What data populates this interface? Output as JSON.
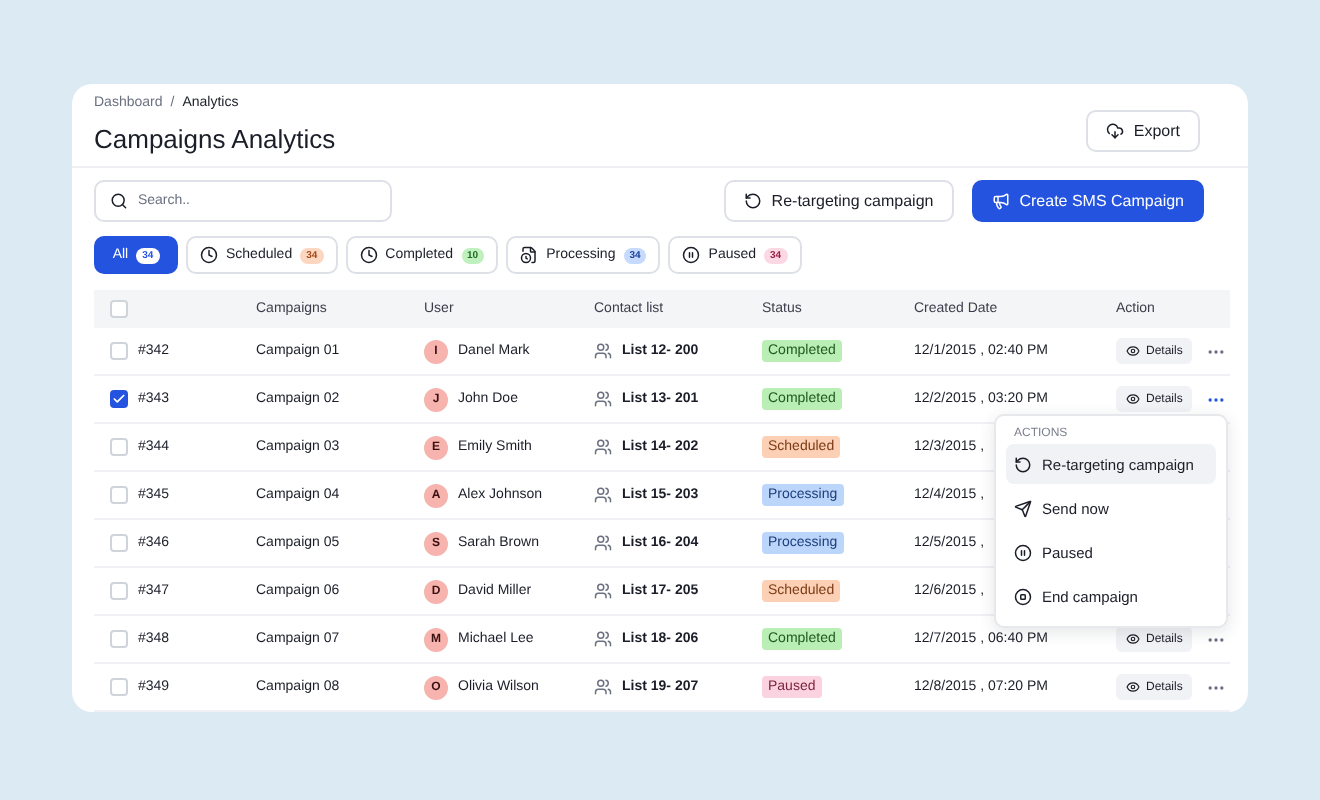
{
  "breadcrumb": [
    "Dashboard",
    "/",
    "Analytics"
  ],
  "title": "Campaigns Analytics",
  "export_button": "Export",
  "search": {
    "placeholder": "Search.."
  },
  "actions": [
    {
      "kind": "retarget",
      "label": "Re-targeting campaign"
    },
    {
      "kind": "create",
      "label": "Create SMS Campaign"
    }
  ],
  "tabs": [
    {
      "kind": "all",
      "label": "All",
      "count": "34",
      "selected": true
    },
    {
      "kind": "scheduled",
      "label": "Scheduled",
      "count": "34",
      "selected": false
    },
    {
      "kind": "completed",
      "label": "Completed",
      "count": "10",
      "selected": false
    },
    {
      "kind": "processing",
      "label": "Processing",
      "count": "34",
      "selected": false
    },
    {
      "kind": "paused",
      "label": "Paused",
      "count": "34",
      "selected": false
    }
  ],
  "table": {
    "header_checked": false,
    "columns": [
      "Campaigns",
      "User",
      "Contact list",
      "Status",
      "Created Date",
      "Action"
    ],
    "rows": [
      {
        "id": "#342",
        "checked": false,
        "campaign": "Campaign 01",
        "initial": "I",
        "user": "Danel Mark",
        "list": "List 12- 200",
        "status": {
          "kind": "completed",
          "label": "Completed"
        },
        "date": "12/1/2015 , 02:40 PM",
        "details": "Details",
        "menu_open": false
      },
      {
        "id": "#343",
        "checked": true,
        "campaign": "Campaign 02",
        "initial": "J",
        "user": "John Doe",
        "list": "List 13- 201",
        "status": {
          "kind": "completed",
          "label": "Completed"
        },
        "date": "12/2/2015 , 03:20 PM",
        "details": "Details",
        "menu_open": true
      },
      {
        "id": "#344",
        "checked": false,
        "campaign": "Campaign 03",
        "initial": "E",
        "user": "Emily Smith",
        "list": "List 14- 202",
        "status": {
          "kind": "scheduled",
          "label": "Scheduled"
        },
        "date": "12/3/2015 ,"
      },
      {
        "id": "#345",
        "checked": false,
        "campaign": "Campaign 04",
        "initial": "A",
        "user": "Alex Johnson",
        "list": "List 15- 203",
        "status": {
          "kind": "processing",
          "label": "Processing"
        },
        "date": "12/4/2015 ,"
      },
      {
        "id": "#346",
        "checked": false,
        "campaign": "Campaign 05",
        "initial": "S",
        "user": "Sarah Brown",
        "list": "List 16- 204",
        "status": {
          "kind": "processing",
          "label": "Processing"
        },
        "date": "12/5/2015 ,"
      },
      {
        "id": "#347",
        "checked": false,
        "campaign": "Campaign 06",
        "initial": "D",
        "user": "David Miller",
        "list": "List 17- 205",
        "status": {
          "kind": "scheduled",
          "label": "Scheduled"
        },
        "date": "12/6/2015 ,"
      },
      {
        "id": "#348",
        "checked": false,
        "campaign": "Campaign 07",
        "initial": "M",
        "user": "Michael Lee",
        "list": "List 18- 206",
        "status": {
          "kind": "completed",
          "label": "Completed"
        },
        "date": "12/7/2015 , 06:40 PM",
        "details": "Details",
        "menu_open": false
      },
      {
        "id": "#349",
        "checked": false,
        "campaign": "Campaign 08",
        "initial": "O",
        "user": "Olivia Wilson",
        "list": "List 19- 207",
        "status": {
          "kind": "paused",
          "label": "Paused"
        },
        "date": "12/8/2015 , 07:20 PM",
        "details": "Details",
        "menu_open": false
      }
    ]
  },
  "menu": {
    "heading": "ACTIONS",
    "items": [
      {
        "kind": "retarget",
        "label": "Re-targeting campaign",
        "selected": true
      },
      {
        "kind": "send",
        "label": "Send now",
        "selected": false
      },
      {
        "kind": "pause",
        "label": "Paused",
        "selected": false
      },
      {
        "kind": "end",
        "label": "End campaign",
        "selected": false
      }
    ]
  }
}
